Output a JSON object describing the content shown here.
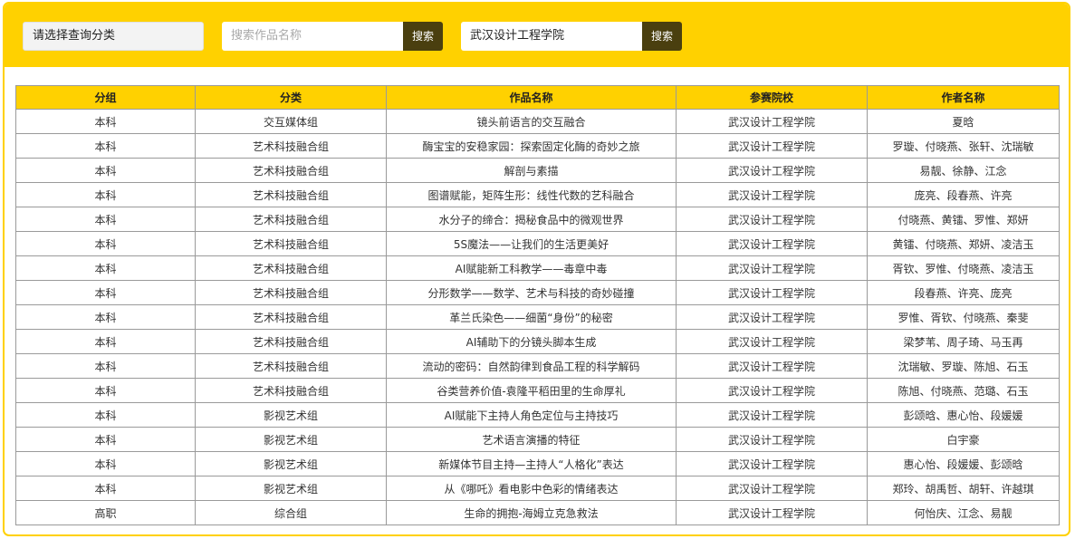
{
  "toolbar": {
    "category_select": "请选择查询分类",
    "work_search": {
      "placeholder": "搜索作品名称",
      "button": "搜索"
    },
    "school_search": {
      "value": "武汉设计工程学院",
      "button": "搜索"
    }
  },
  "table": {
    "headers": [
      "分组",
      "分类",
      "作品名称",
      "参赛院校",
      "作者名称"
    ],
    "rows": [
      [
        "本科",
        "交互媒体组",
        "镜头前语言的交互融合",
        "武汉设计工程学院",
        "夏晗"
      ],
      [
        "本科",
        "艺术科技融合组",
        "酶宝宝的安稳家园：探索固定化酶的奇妙之旅",
        "武汉设计工程学院",
        "罗璇、付晓燕、张轩、沈瑞敏"
      ],
      [
        "本科",
        "艺术科技融合组",
        "解剖与素描",
        "武汉设计工程学院",
        "易靓、徐静、江念"
      ],
      [
        "本科",
        "艺术科技融合组",
        "图谱赋能，矩阵生形：线性代数的艺科融合",
        "武汉设计工程学院",
        "庞亮、段春燕、许亮"
      ],
      [
        "本科",
        "艺术科技融合组",
        "水分子的缔合：揭秘食品中的微观世界",
        "武汉设计工程学院",
        "付晓燕、黄镭、罗惟、郑妍"
      ],
      [
        "本科",
        "艺术科技融合组",
        "5S魔法——让我们的生活更美好",
        "武汉设计工程学院",
        "黄镭、付晓燕、郑妍、凌洁玉"
      ],
      [
        "本科",
        "艺术科技融合组",
        "AI赋能新工科教学——毒章中毒",
        "武汉设计工程学院",
        "胥钦、罗惟、付晓燕、凌洁玉"
      ],
      [
        "本科",
        "艺术科技融合组",
        "分形数学——数学、艺术与科技的奇妙碰撞",
        "武汉设计工程学院",
        "段春燕、许亮、庞亮"
      ],
      [
        "本科",
        "艺术科技融合组",
        "革兰氏染色——细菌“身份”的秘密",
        "武汉设计工程学院",
        "罗惟、胥钦、付晓燕、秦斐"
      ],
      [
        "本科",
        "艺术科技融合组",
        "AI辅助下的分镜头脚本生成",
        "武汉设计工程学院",
        "梁梦苇、周子琦、马玉再"
      ],
      [
        "本科",
        "艺术科技融合组",
        "流动的密码：自然韵律到食品工程的科学解码",
        "武汉设计工程学院",
        "沈瑞敏、罗璇、陈旭、石玉"
      ],
      [
        "本科",
        "艺术科技融合组",
        "谷类营养价值-袁隆平稻田里的生命厚礼",
        "武汉设计工程学院",
        "陈旭、付晓燕、范璐、石玉"
      ],
      [
        "本科",
        "影视艺术组",
        "AI赋能下主持人角色定位与主持技巧",
        "武汉设计工程学院",
        "彭颂晗、惠心怡、段媛媛"
      ],
      [
        "本科",
        "影视艺术组",
        "艺术语言演播的特征",
        "武汉设计工程学院",
        "白宇豪"
      ],
      [
        "本科",
        "影视艺术组",
        "新媒体节目主持—主持人“人格化”表达",
        "武汉设计工程学院",
        "惠心怡、段媛媛、彭颂晗"
      ],
      [
        "本科",
        "影视艺术组",
        "从《哪吒》看电影中色彩的情绪表达",
        "武汉设计工程学院",
        "郑玲、胡禹哲、胡轩、许越琪"
      ],
      [
        "高职",
        "综合组",
        "生命的拥抱-海姆立克急救法",
        "武汉设计工程学院",
        "何怡庆、江念、易靓"
      ]
    ]
  }
}
